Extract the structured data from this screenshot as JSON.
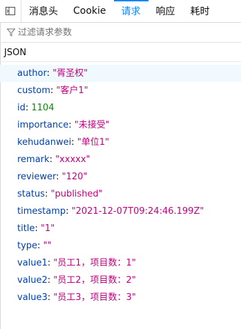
{
  "tabs": [
    {
      "label": "消息头",
      "active": false
    },
    {
      "label": "Cookie",
      "active": false
    },
    {
      "label": "请求",
      "active": true
    },
    {
      "label": "响应",
      "active": false
    },
    {
      "label": "耗时",
      "active": false
    }
  ],
  "filter": {
    "placeholder": "过滤请求参数",
    "value": ""
  },
  "section": {
    "title": "JSON"
  },
  "colors": {
    "accent": "#0a84ff",
    "key": "#003eaa",
    "string": "#c2007d",
    "number": "#058b00"
  },
  "json": [
    {
      "key": "author",
      "value": "\"胥圣权\"",
      "type": "string"
    },
    {
      "key": "custom",
      "value": "\"客户1\"",
      "type": "string"
    },
    {
      "key": "id",
      "value": "1104",
      "type": "number"
    },
    {
      "key": "importance",
      "value": "\"未接受\"",
      "type": "string"
    },
    {
      "key": "kehudanwei",
      "value": "\"单位1\"",
      "type": "string"
    },
    {
      "key": "remark",
      "value": "\"xxxxx\"",
      "type": "string"
    },
    {
      "key": "reviewer",
      "value": "\"120\"",
      "type": "string"
    },
    {
      "key": "status",
      "value": "\"published\"",
      "type": "string"
    },
    {
      "key": "timestamp",
      "value": "\"2021-12-07T09:24:46.199Z\"",
      "type": "string"
    },
    {
      "key": "title",
      "value": "\"1\"",
      "type": "string"
    },
    {
      "key": "type",
      "value": "\"\"",
      "type": "string"
    },
    {
      "key": "value1",
      "value": "\"员工1，项目数：1\"",
      "type": "string"
    },
    {
      "key": "value2",
      "value": "\"员工2，项目数：2\"",
      "type": "string"
    },
    {
      "key": "value3",
      "value": "\"员工3，项目数：3\"",
      "type": "string"
    }
  ]
}
